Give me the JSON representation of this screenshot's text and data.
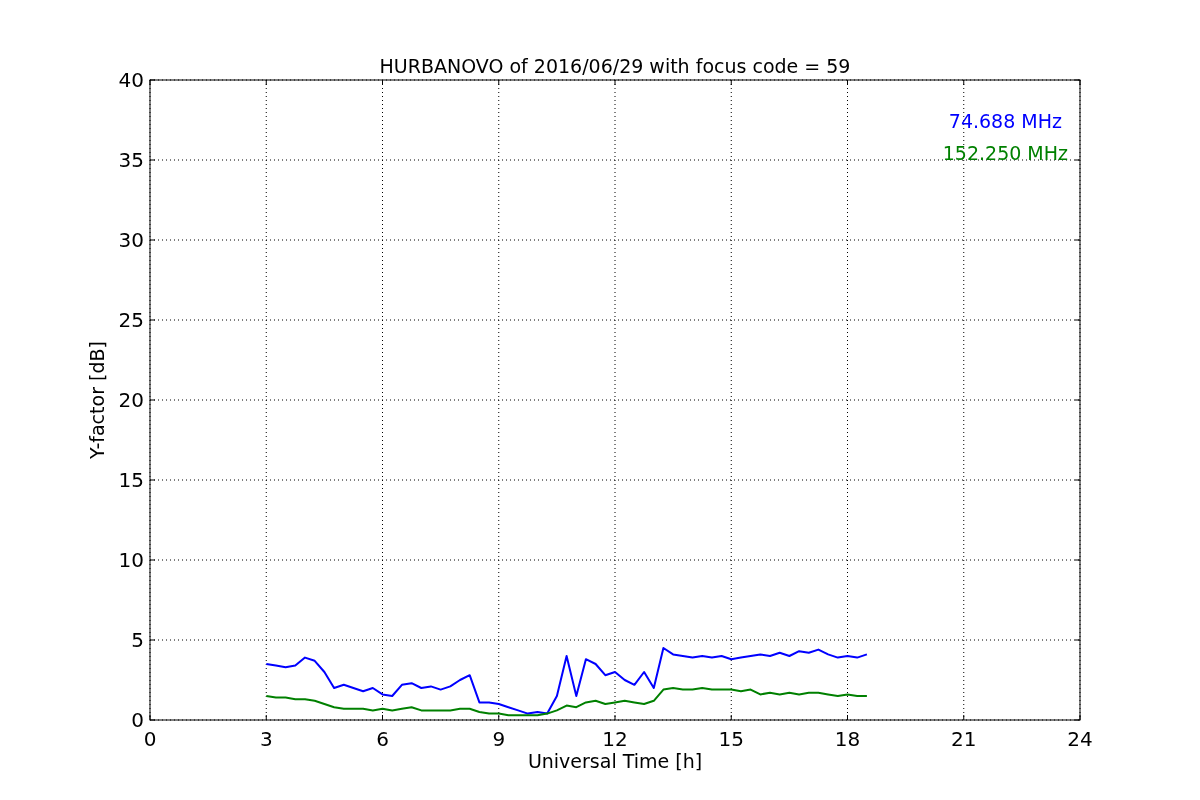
{
  "chart_data": {
    "type": "line",
    "title": "HURBANOVO of 2016/06/29 with focus code = 59",
    "xlabel": "Universal Time [h]",
    "ylabel": "Y-factor [dB]",
    "grid": true,
    "xlim": [
      0,
      24
    ],
    "ylim": [
      0,
      40
    ],
    "xticks": [
      0,
      3,
      6,
      9,
      12,
      15,
      18,
      21,
      24
    ],
    "yticks": [
      0,
      5,
      10,
      15,
      20,
      25,
      30,
      35,
      40
    ],
    "x": [
      3,
      3.25,
      3.5,
      3.75,
      4,
      4.25,
      4.5,
      4.75,
      5,
      5.25,
      5.5,
      5.75,
      6,
      6.25,
      6.5,
      6.75,
      7,
      7.25,
      7.5,
      7.75,
      8,
      8.25,
      8.5,
      8.75,
      9,
      9.25,
      9.5,
      9.75,
      10,
      10.25,
      10.5,
      10.75,
      11,
      11.25,
      11.5,
      11.75,
      12,
      12.25,
      12.5,
      12.75,
      13,
      13.25,
      13.5,
      13.75,
      14,
      14.25,
      14.5,
      14.75,
      15,
      15.25,
      15.5,
      15.75,
      16,
      16.25,
      16.5,
      16.75,
      17,
      17.25,
      17.5,
      17.75,
      18,
      18.25,
      18.5
    ],
    "series": [
      {
        "name": "74.688 MHz",
        "color": "#0000ff",
        "values": [
          3.5,
          3.4,
          3.3,
          3.4,
          3.9,
          3.7,
          3.0,
          2.0,
          2.2,
          2.0,
          1.8,
          2.0,
          1.6,
          1.5,
          2.2,
          2.3,
          2.0,
          2.1,
          1.9,
          2.1,
          2.5,
          2.8,
          1.1,
          1.1,
          1.0,
          0.8,
          0.6,
          0.4,
          0.5,
          0.4,
          1.5,
          4.0,
          1.5,
          3.8,
          3.5,
          2.8,
          3.0,
          2.5,
          2.2,
          3.0,
          2.0,
          4.5,
          4.1,
          4.0,
          3.9,
          4.0,
          3.9,
          4.0,
          3.8,
          3.9,
          4.0,
          4.1,
          4.0,
          4.2,
          4.0,
          4.3,
          4.2,
          4.4,
          4.1,
          3.9,
          4.0,
          3.9,
          4.1
        ]
      },
      {
        "name": "152.250 MHz",
        "color": "#008000",
        "values": [
          1.5,
          1.4,
          1.4,
          1.3,
          1.3,
          1.2,
          1.0,
          0.8,
          0.7,
          0.7,
          0.7,
          0.6,
          0.7,
          0.6,
          0.7,
          0.8,
          0.6,
          0.6,
          0.6,
          0.6,
          0.7,
          0.7,
          0.5,
          0.4,
          0.4,
          0.3,
          0.3,
          0.3,
          0.3,
          0.4,
          0.6,
          0.9,
          0.8,
          1.1,
          1.2,
          1.0,
          1.1,
          1.2,
          1.1,
          1.0,
          1.2,
          1.9,
          2.0,
          1.9,
          1.9,
          2.0,
          1.9,
          1.9,
          1.9,
          1.8,
          1.9,
          1.6,
          1.7,
          1.6,
          1.7,
          1.6,
          1.7,
          1.7,
          1.6,
          1.5,
          1.6,
          1.5,
          1.5
        ]
      }
    ]
  }
}
